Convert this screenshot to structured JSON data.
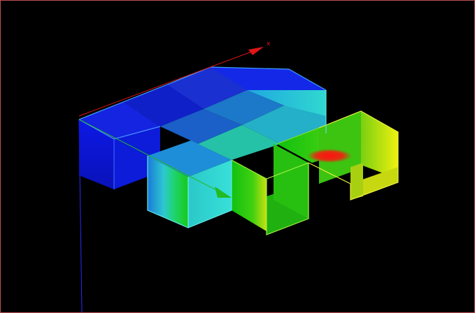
{
  "viewport": {
    "background": "#000000",
    "border_color": "#c0504d"
  },
  "axes": {
    "x": {
      "label": "x",
      "color": "#e01515"
    },
    "y": {
      "label": "",
      "color": "#22bb22"
    },
    "z": {
      "label": "",
      "color": "#2a2aff"
    }
  },
  "model": {
    "description_colors": [
      "#1010e0",
      "#1faee0",
      "#2fd9cf",
      "#14c814",
      "#e8e814",
      "#e01010"
    ],
    "hot_spot_color": "#e01010"
  }
}
